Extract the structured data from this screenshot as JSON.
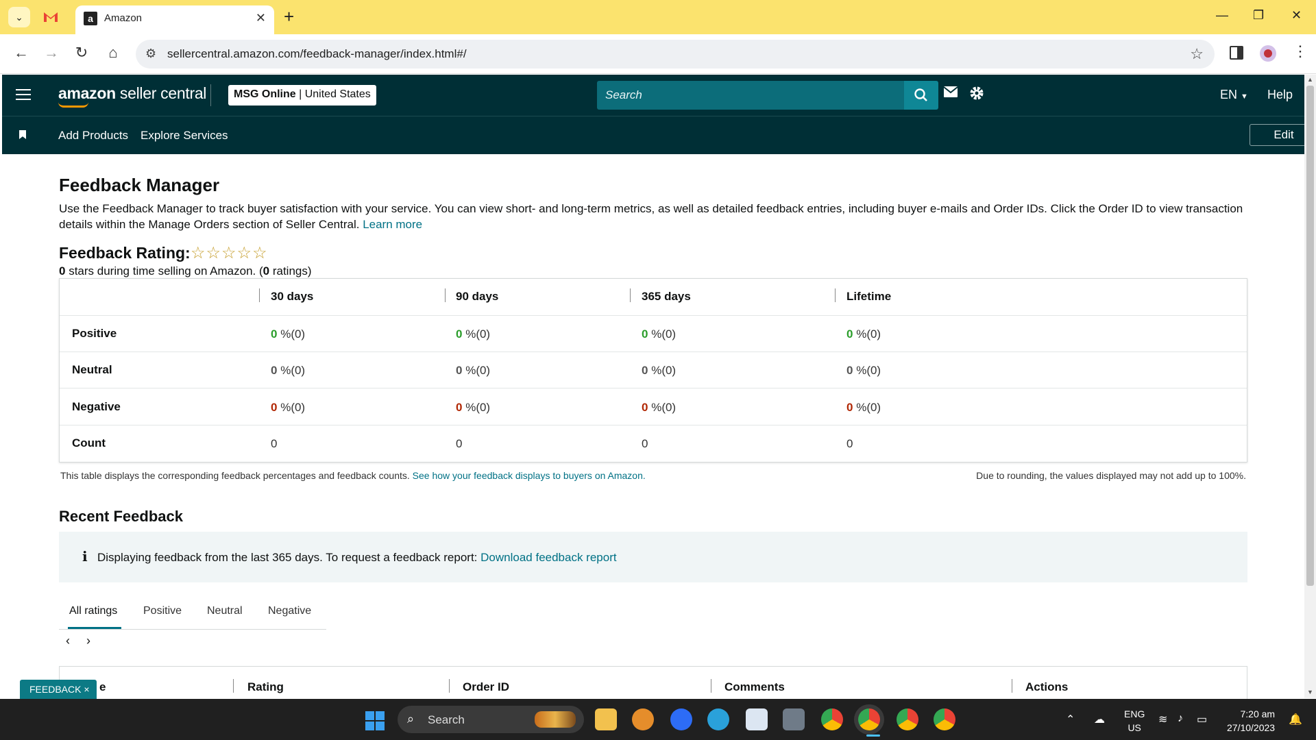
{
  "browser": {
    "tab_title": "Amazon",
    "url": "sellercentral.amazon.com/feedback-manager/index.html#/"
  },
  "header": {
    "logo_bold": "amazon",
    "logo_rest": " seller central",
    "store_name": "MSG Online",
    "store_region": "United States",
    "search_placeholder": "Search",
    "language": "EN",
    "help": "Help"
  },
  "subnav": {
    "links": [
      "Add Products",
      "Explore Services"
    ],
    "edit_label": "Edit"
  },
  "page": {
    "title": "Feedback Manager",
    "intro": "Use the Feedback Manager to track buyer satisfaction with your service. You can view short- and long-term metrics, as well as detailed feedback entries, including buyer e-mails and Order IDs. Click the Order ID to view transaction details within the Manage Orders section of Seller Central.",
    "learn_more": "Learn more",
    "rating_title": "Feedback Rating:",
    "stars": "☆☆☆☆☆",
    "rating_stars_value": "0",
    "rating_mid": " stars during time selling on Amazon. (",
    "rating_count": "0",
    "rating_tail": " ratings)"
  },
  "feedback_table": {
    "columns": [
      "30 days",
      "90 days",
      "365 days",
      "Lifetime"
    ],
    "rows": [
      {
        "label": "Positive",
        "pct": [
          "0",
          "0",
          "0",
          "0"
        ],
        "count": [
          "(0)",
          "(0)",
          "(0)",
          "(0)"
        ]
      },
      {
        "label": "Neutral",
        "pct": [
          "0",
          "0",
          "0",
          "0"
        ],
        "count": [
          "(0)",
          "(0)",
          "(0)",
          "(0)"
        ]
      },
      {
        "label": "Negative",
        "pct": [
          "0",
          "0",
          "0",
          "0"
        ],
        "count": [
          "(0)",
          "(0)",
          "(0)",
          "(0)"
        ]
      },
      {
        "label": "Count",
        "values": [
          "0",
          "0",
          "0",
          "0"
        ]
      }
    ],
    "pct_sign": " %",
    "footer_left": "This table displays the corresponding feedback percentages and feedback counts.",
    "footer_link": "See how your feedback displays to buyers on Amazon.",
    "footer_right": "Due to rounding, the values displayed may not add up to 100%."
  },
  "recent": {
    "title": "Recent Feedback",
    "info_icon": "i",
    "info_text": "Displaying feedback from the last 365 days. To request a feedback report:",
    "info_link": "Download feedback report",
    "tabs": [
      "All ratings",
      "Positive",
      "Neutral",
      "Negative"
    ],
    "prev": "‹",
    "next": "›",
    "columns": [
      "e",
      "Rating",
      "Order ID",
      "Comments",
      "Actions"
    ]
  },
  "feedback_badge": "FEEDBACK",
  "feedback_badge_close": "×",
  "taskbar": {
    "search": "Search",
    "lang_1": "ENG",
    "lang_2": "US",
    "time": "7:20 am",
    "date": "27/10/2023"
  },
  "colors": {
    "header_bg": "#002f36",
    "link": "#007185",
    "positive": "#2a9d2a",
    "negative": "#b12704",
    "tabbar": "#fbe36e"
  }
}
